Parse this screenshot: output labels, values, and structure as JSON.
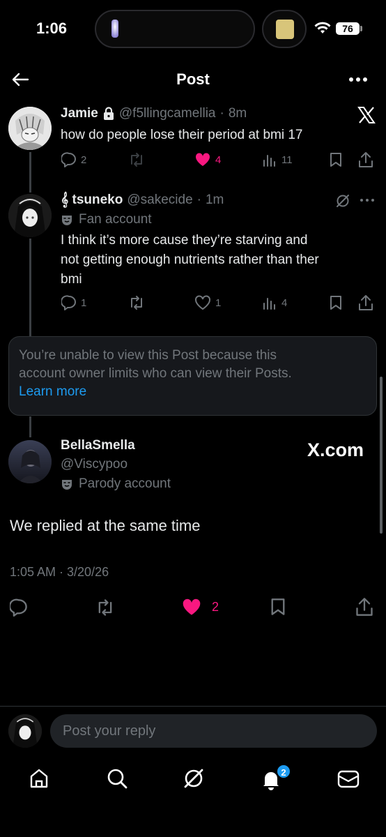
{
  "status_bar": {
    "time": "1:06",
    "battery": "76"
  },
  "header": {
    "title": "Post"
  },
  "thread": [
    {
      "name": "Jamie",
      "handle": "@f5llingcamellia",
      "time": "8m",
      "text": "how do people lose their period at bmi 17",
      "replies": "2",
      "likes": "4",
      "views": "11",
      "liked": true
    },
    {
      "name": "𝄞 tsuneko",
      "handle": "@sakecide",
      "time": "1m",
      "badge": "Fan account",
      "text_lines": [
        "I think it’s more cause they’re starving and",
        "not getting enough nutrients rather than ther",
        "bmi"
      ],
      "replies": "1",
      "likes": "1",
      "views": "4"
    }
  ],
  "notice": {
    "line1": "You’re unable to view this Post because this",
    "line2": "account owner limits who can view their Posts.",
    "link": "Learn more"
  },
  "main_post": {
    "name": "BellaSmella",
    "handle": "@Viscypoo",
    "badge": "Parody account",
    "text": "We replied at the same time",
    "timestamp": "1:05 AM · 3/20/26",
    "likes": "2",
    "watermark": "X.com"
  },
  "reply": {
    "placeholder": "Post your reply"
  },
  "nav": {
    "notifications_count": "2"
  },
  "colors": {
    "like_pink": "#f91880",
    "link_blue": "#1d9bf0",
    "muted": "#71767b"
  },
  "icons": [
    "back-arrow-icon",
    "more-icon",
    "x-logo-icon",
    "lock-icon",
    "reply-icon",
    "repost-icon",
    "heart-icon",
    "views-icon",
    "bookmark-icon",
    "share-icon",
    "grok-icon",
    "mask-icon",
    "home-icon",
    "search-icon",
    "notifications-icon",
    "messages-icon"
  ]
}
